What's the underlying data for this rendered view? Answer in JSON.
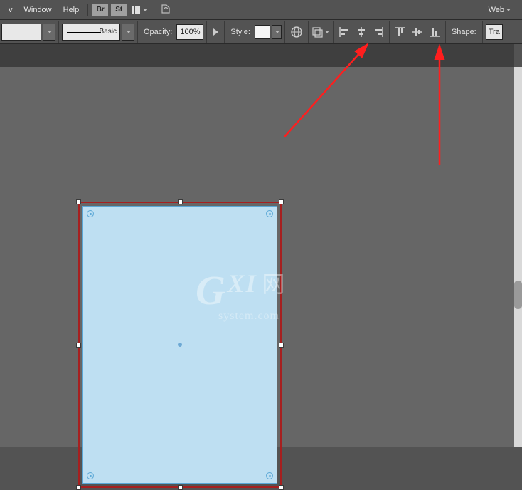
{
  "menu": {
    "view_frag": "v",
    "window": "Window",
    "help": "Help",
    "bridge_badge": "Br",
    "stock_badge": "St",
    "workspace": "Web"
  },
  "options": {
    "stroke_style_label": "Basic",
    "opacity_label": "Opacity:",
    "opacity_value": "100%",
    "style_label": "Style:",
    "shape_label": "Shape:",
    "transform_frag": "Tra"
  },
  "shape": {
    "fill_color": "#bedff2",
    "selection_stroke": "#a61f1f"
  },
  "watermark": {
    "line1a": "G",
    "line1b": "XI",
    "line1c": "网",
    "line2": "system.com"
  }
}
